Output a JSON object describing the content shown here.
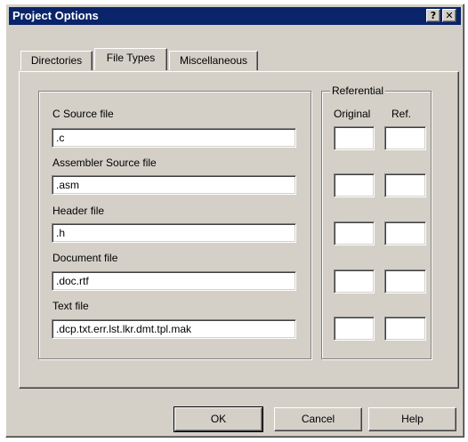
{
  "window": {
    "title": "Project Options",
    "help_button": "?",
    "close_button": "✕"
  },
  "tabs": [
    {
      "label": "Directories",
      "active": false
    },
    {
      "label": "File Types",
      "active": true
    },
    {
      "label": "Miscellaneous",
      "active": false
    }
  ],
  "file_types": {
    "c_source": {
      "label": "C Source file",
      "value": ".c"
    },
    "assembler_source": {
      "label": "Assembler Source file",
      "value": ".asm"
    },
    "header": {
      "label": "Header file",
      "value": ".h"
    },
    "document": {
      "label": "Document file",
      "value": ".doc.rtf"
    },
    "text": {
      "label": "Text file",
      "value": ".dcp.txt.err.lst.lkr.dmt.tpl.mak"
    }
  },
  "referential": {
    "title": "Referential",
    "col_original": "Original",
    "col_ref": "Ref.",
    "rows": [
      {
        "original": "",
        "ref": ""
      },
      {
        "original": "",
        "ref": ""
      },
      {
        "original": "",
        "ref": ""
      },
      {
        "original": "",
        "ref": ""
      },
      {
        "original": "",
        "ref": ""
      }
    ]
  },
  "buttons": {
    "ok": "OK",
    "cancel": "Cancel",
    "help": "Help"
  }
}
